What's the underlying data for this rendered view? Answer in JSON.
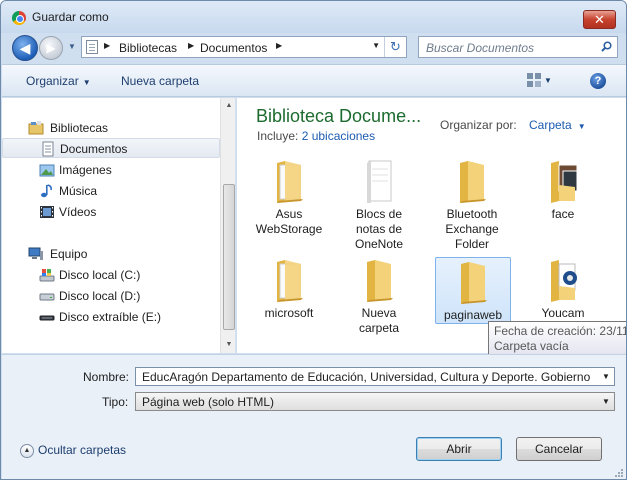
{
  "window": {
    "title": "Guardar como",
    "close_glyph": "✕"
  },
  "nav": {
    "back_glyph": "◀",
    "forward_glyph": "▶",
    "breadcrumb": [
      "Bibliotecas",
      "Documentos"
    ],
    "search_placeholder": "Buscar Documentos",
    "refresh_glyph": "↻"
  },
  "toolbar": {
    "organize": "Organizar",
    "new_folder": "Nueva carpeta",
    "help_glyph": "?"
  },
  "sidebar": {
    "items": [
      {
        "label": "Bibliotecas",
        "icon": "library-icon"
      },
      {
        "label": "Documentos",
        "icon": "document-icon",
        "selected": true
      },
      {
        "label": "Imágenes",
        "icon": "image-icon"
      },
      {
        "label": "Música",
        "icon": "music-icon"
      },
      {
        "label": "Vídeos",
        "icon": "video-icon"
      },
      {
        "label": "Equipo",
        "icon": "computer-icon"
      },
      {
        "label": "Disco local (C:)",
        "icon": "drive-c-icon"
      },
      {
        "label": "Disco local (D:)",
        "icon": "drive-icon"
      },
      {
        "label": "Disco extraíble (E:)",
        "icon": "removable-drive-icon"
      }
    ]
  },
  "library": {
    "title": "Biblioteca Docume...",
    "includes_label": "Incluye:",
    "includes_link": "2 ubicaciones",
    "arrange_label": "Organizar por:",
    "arrange_value": "Carpeta"
  },
  "files": [
    {
      "label": "Asus WebStorage",
      "icon": "folder-icon"
    },
    {
      "label": "Blocs de notas de OneNote",
      "icon": "notebook-folder-icon"
    },
    {
      "label": "Bluetooth Exchange Folder",
      "icon": "folder-icon"
    },
    {
      "label": "face",
      "icon": "image-folder-icon"
    },
    {
      "label": "microsoft",
      "icon": "folder-icon"
    },
    {
      "label": "Nueva carpeta",
      "icon": "folder-icon"
    },
    {
      "label": "paginaweb",
      "icon": "folder-icon",
      "hovered": true
    },
    {
      "label": "Youcam",
      "icon": "media-folder-icon"
    }
  ],
  "tooltip": {
    "line1": "Fecha de creación: 23/11/",
    "line2": "Carpeta vacía"
  },
  "form": {
    "name_label": "Nombre:",
    "name_value": "EducAragón    Departamento de Educación, Universidad, Cultura y Deporte. Gobierno",
    "type_label": "Tipo:",
    "type_value": "Página web (solo HTML)"
  },
  "footer": {
    "hide_folders": "Ocultar carpetas",
    "open": "Abrir",
    "cancel": "Cancelar"
  },
  "colors": {
    "accent_title": "#1d6b2e",
    "link": "#1c5bb0",
    "chrome": "#cfdff0"
  }
}
